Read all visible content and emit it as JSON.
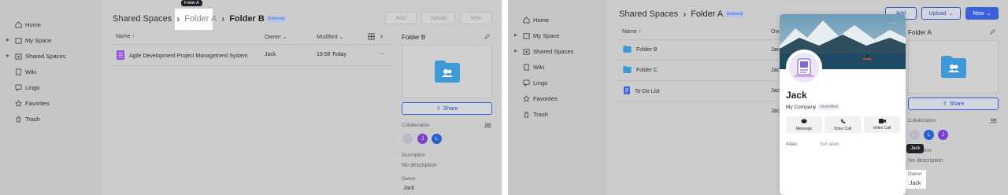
{
  "left": {
    "sidebar": {
      "items": [
        {
          "label": "Home",
          "icon": "home-icon"
        },
        {
          "label": "My Space",
          "icon": "folder-icon"
        },
        {
          "label": "Shared Spaces",
          "icon": "share-icon"
        },
        {
          "label": "Wiki",
          "icon": "book-icon"
        },
        {
          "label": "Lingo",
          "icon": "chat-icon"
        },
        {
          "label": "Favorites",
          "icon": "star-icon"
        },
        {
          "label": "Trash",
          "icon": "trash-icon"
        }
      ]
    },
    "breadcrumb": {
      "root": "Shared Spaces",
      "middle": "Folder A",
      "current": "Folder B",
      "tag": "External"
    },
    "tooltip": "Folder A",
    "toolbar": {
      "add": "Add",
      "upload": "Upload",
      "new": "New"
    },
    "columns": {
      "name": "Name ↑",
      "owner": "Owner",
      "modified": "Modified"
    },
    "rows": [
      {
        "name": "Agile Development Project Management System",
        "owner": "Jack",
        "modified": "19:58 Today",
        "more": "···"
      }
    ],
    "detail": {
      "title": "Folder B",
      "share": "Share",
      "collaborators_label": "Collaborators",
      "avatars": [
        {
          "letter": "",
          "color": "#b9b9c8"
        },
        {
          "letter": "J",
          "color": "#7b3fd1"
        },
        {
          "letter": "L",
          "color": "#2b5fd4"
        }
      ],
      "description_label": "Description",
      "description": "No description",
      "owner_label": "Owner",
      "owner": "Jack"
    }
  },
  "right": {
    "sidebar": {
      "items": [
        {
          "label": "Home"
        },
        {
          "label": "My Space"
        },
        {
          "label": "Shared Spaces"
        },
        {
          "label": "Wiki"
        },
        {
          "label": "Lingo"
        },
        {
          "label": "Favorites"
        },
        {
          "label": "Trash"
        }
      ]
    },
    "breadcrumb": {
      "root": "Shared Spaces",
      "current": "Folder A",
      "tag": "External"
    },
    "toolbar": {
      "add": "Add",
      "upload": "Upload",
      "new": "New"
    },
    "columns": {
      "name": "Name ↑",
      "owner": "Own"
    },
    "rows": [
      {
        "name": "Folder B",
        "owner": "Jack",
        "type": "folder"
      },
      {
        "name": "Folder C",
        "owner": "Jack",
        "type": "folder"
      },
      {
        "name": "To-Do List",
        "owner": "Jack",
        "type": "doc"
      },
      {
        "name": "",
        "owner": "Jack",
        "type": "none"
      }
    ],
    "detail": {
      "title": "Folder A",
      "share": "Share",
      "collaborators_label": "Collaborators",
      "avatars": [
        {
          "letter": "",
          "color": "#b9b9c8"
        },
        {
          "letter": "L",
          "color": "#2b5fd4"
        },
        {
          "letter": "J",
          "color": "#7b3fd1"
        }
      ],
      "description_label": "Description",
      "description": "No description",
      "owner_label": "Owner",
      "owner": "Jack"
    },
    "tooltip": "Jack",
    "card": {
      "name": "Jack",
      "company": "My Company",
      "badge": "Unverified",
      "actions": [
        "Message",
        "Voice Call",
        "Video Call"
      ],
      "alias_label": "Alias",
      "alias_action": "Set alias",
      "more": "···"
    }
  },
  "colors": {
    "accent": "#3b62d9",
    "folder": "#3d9ad6",
    "sheet": "#8b4fd6"
  }
}
